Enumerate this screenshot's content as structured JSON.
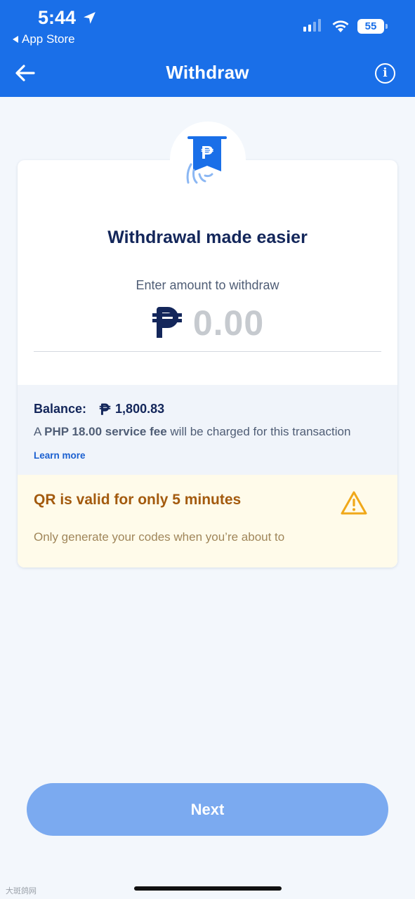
{
  "colors": {
    "brand": "#1a6fe8",
    "navy": "#13265a",
    "button": "#7baaf0",
    "warning": "#a35a0e",
    "warning_bg": "#fffbea"
  },
  "status_bar": {
    "time": "5:44",
    "back_app": "App Store",
    "battery": "55"
  },
  "nav": {
    "title": "Withdraw",
    "info_icon": "info-icon",
    "back_icon": "arrow-left-icon"
  },
  "card": {
    "title": "Withdrawal made easier",
    "prompt": "Enter amount to withdraw",
    "currency_symbol": "₱",
    "amount_placeholder": "0.00"
  },
  "balance": {
    "label": "Balance:",
    "value": "1,800.83",
    "fee_prefix": "A ",
    "fee_bold": "PHP 18.00 service fee",
    "fee_suffix": " will be charged for this transaction",
    "learn_more": "Learn more"
  },
  "warning": {
    "title": "QR is valid for only 5 minutes",
    "body": "Only generate your codes when you’re about to"
  },
  "footer": {
    "next_label": "Next",
    "watermark": "大斑鸽网"
  }
}
